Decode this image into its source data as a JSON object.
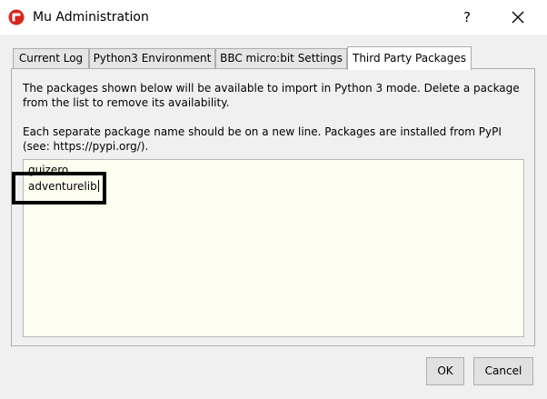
{
  "window": {
    "title": "Mu Administration",
    "help_label": "?"
  },
  "tabs": [
    {
      "label": "Current Log",
      "active": false
    },
    {
      "label": "Python3 Environment",
      "active": false
    },
    {
      "label": "BBC micro:bit Settings",
      "active": false
    },
    {
      "label": "Third Party Packages",
      "active": true
    }
  ],
  "packages_panel": {
    "description_1": "The packages shown below will be available to import in Python 3 mode. Delete a package from the list to remove its availability.",
    "description_2": "Each separate package name should be on a new line. Packages are installed from PyPI (see: https://pypi.org/).",
    "packages": [
      "guizero",
      "adventurelib"
    ]
  },
  "buttons": {
    "ok_label": "OK",
    "cancel_label": "Cancel"
  },
  "colors": {
    "app_icon": "#d9251c",
    "text_area_bg": "#fdfdf0"
  }
}
